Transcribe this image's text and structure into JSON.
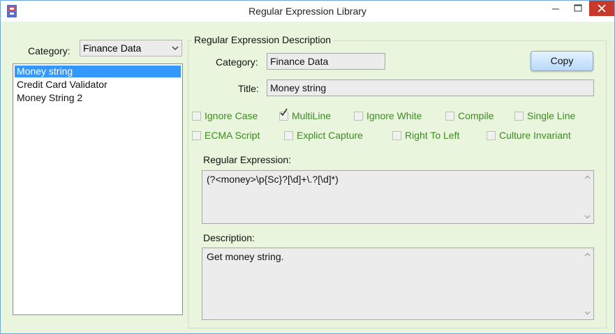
{
  "window": {
    "title": "Regular Expression Library"
  },
  "left": {
    "category_label": "Category:",
    "category_value": "Finance Data",
    "items": [
      "Money string",
      "Credit Card Validator",
      "Money String 2"
    ]
  },
  "desc": {
    "group_title": "Regular Expression Description",
    "category_label": "Category:",
    "category_value": "Finance Data",
    "title_label": "Title:",
    "title_value": "Money string",
    "copy_label": "Copy",
    "options": [
      {
        "label": "Ignore Case",
        "checked": false
      },
      {
        "label": "MultiLine",
        "checked": true
      },
      {
        "label": "Ignore White",
        "checked": false
      },
      {
        "label": "Compile",
        "checked": false
      },
      {
        "label": "Single Line",
        "checked": false
      },
      {
        "label": "ECMA Script",
        "checked": false
      },
      {
        "label": "Explict Capture",
        "checked": false
      },
      {
        "label": "Right To Left",
        "checked": false
      },
      {
        "label": "Culture Invariant",
        "checked": false
      }
    ],
    "regex_label": "Regular Expression:",
    "regex_value": "(?<money>\\p{Sc}?[\\d]+\\.?[\\d]*)",
    "description_label": "Description:",
    "description_value": "Get money string."
  },
  "colors": {
    "window_bg": "#e9f5dc",
    "selection": "#3399ff",
    "option_text": "#3e8a25"
  }
}
